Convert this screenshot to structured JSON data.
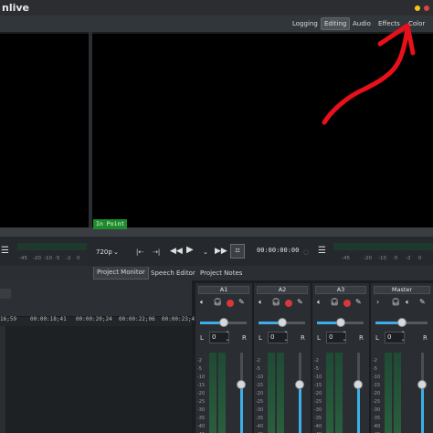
{
  "window": {
    "title": "nlive",
    "controls": [
      "minimize-dot",
      "close-dot"
    ],
    "colors": {
      "minimize": "#f5c518",
      "close": "#e0443e"
    }
  },
  "workspace_tabs": [
    {
      "label": "Logging",
      "active": false
    },
    {
      "label": "Editing",
      "active": true
    },
    {
      "label": "Audio",
      "active": false
    },
    {
      "label": "Effects",
      "active": false
    },
    {
      "label": "Color",
      "active": false
    }
  ],
  "monitor": {
    "in_point_label": "In Point",
    "resolution": "720p",
    "timecode": "00:00:00:00",
    "scale_left": [
      "-45",
      "-20",
      "-10",
      "-5",
      "-2",
      "0"
    ],
    "scale_right": [
      "-45",
      "-20",
      "-10",
      "-5",
      "-2",
      "0"
    ]
  },
  "bottom_tabs": [
    {
      "label": "Project Monitor",
      "active": true
    },
    {
      "label": "Speech Editor",
      "active": false
    },
    {
      "label": "Project Notes",
      "active": false
    }
  ],
  "timeline": {
    "timecodes": [
      "16;59",
      "00:00:18;41",
      "00:00:20;24",
      "00:00:22;06",
      "00:00:23;4"
    ]
  },
  "mixer": {
    "strips": [
      {
        "name": "A1",
        "value": "0",
        "has_record": true
      },
      {
        "name": "A2",
        "value": "0",
        "has_record": true
      },
      {
        "name": "A3",
        "value": "0",
        "has_record": true
      },
      {
        "name": "Master",
        "value": "0",
        "has_record": false
      }
    ],
    "db_scale": [
      "-2",
      "-5",
      "-10",
      "-15",
      "-20",
      "-25",
      "-30",
      "-35",
      "-40",
      "-45"
    ],
    "pan_left": "L",
    "pan_right": "R",
    "accent": "#3daee9"
  },
  "icons": {
    "play": "play-icon",
    "rewind": "rewind-icon",
    "fast_forward": "fast-forward-icon",
    "menu": "hamburger-icon",
    "speaker": "speaker-icon",
    "headphones": "headphones-icon",
    "record": "record-icon",
    "wand": "magic-wand-icon",
    "crop": "crop-icon"
  },
  "annotation": {
    "color": "#e8101a",
    "shape": "hand-drawn arrow pointing to Color tab"
  }
}
